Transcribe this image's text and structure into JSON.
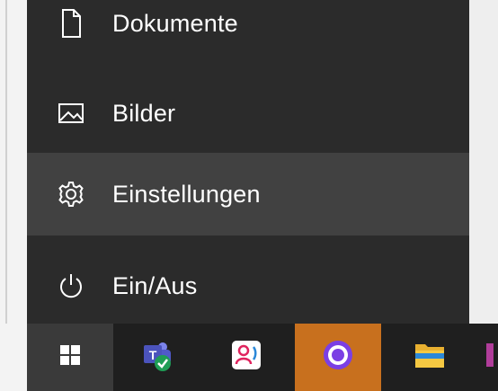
{
  "start_menu": {
    "items": [
      {
        "label": "Dokumente",
        "icon": "document-icon"
      },
      {
        "label": "Bilder",
        "icon": "pictures-icon"
      },
      {
        "label": "Einstellungen",
        "icon": "settings-gear-icon",
        "highlighted": true
      },
      {
        "label": "Ein/Aus",
        "icon": "power-icon"
      }
    ]
  },
  "taskbar": {
    "buttons": [
      {
        "name": "start",
        "icon": "windows-logo-icon"
      },
      {
        "name": "teams",
        "icon": "teams-icon"
      },
      {
        "name": "contacts",
        "icon": "contacts-icon"
      },
      {
        "name": "cortana",
        "icon": "cortana-icon",
        "active": true
      },
      {
        "name": "file-explorer",
        "icon": "folder-icon"
      }
    ]
  },
  "colors": {
    "menu_bg": "#2b2b2b",
    "highlight_bg": "#414141",
    "taskbar_bg": "#1f1f1f",
    "cortana_accent": "#c8701e"
  }
}
